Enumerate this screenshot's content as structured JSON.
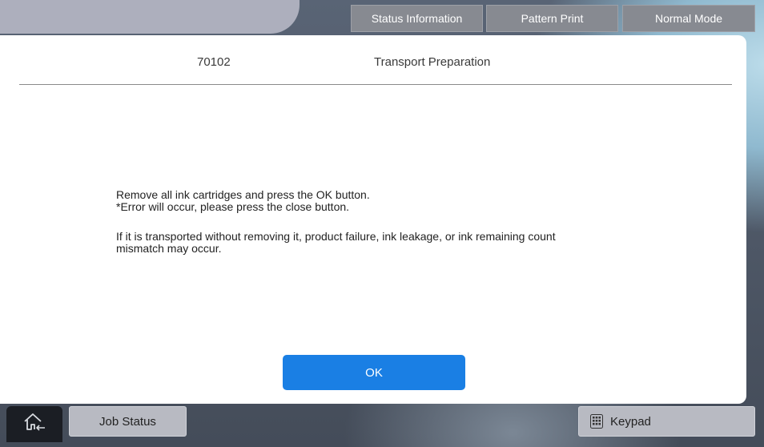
{
  "header": {
    "status_info_label": "Status Information",
    "pattern_print_label": "Pattern Print",
    "normal_mode_label": "Normal Mode"
  },
  "dialog": {
    "code": "70102",
    "title": "Transport Preparation",
    "message_line1": "Remove all ink cartridges and press the OK button.",
    "message_line2": "*Error will occur, please press the close button.",
    "message_line3": "If it is transported without removing it, product failure, ink leakage, or ink remaining count",
    "message_line4": "mismatch may occur.",
    "ok_label": "OK"
  },
  "footer": {
    "job_status_label": "Job Status",
    "keypad_label": "Keypad"
  },
  "icons": {
    "home": "home-icon",
    "keypad": "keypad-icon"
  },
  "colors": {
    "ok_button": "#1a7fe4",
    "dialog_bg": "#ffffff",
    "top_button_bg": "#878a91"
  }
}
